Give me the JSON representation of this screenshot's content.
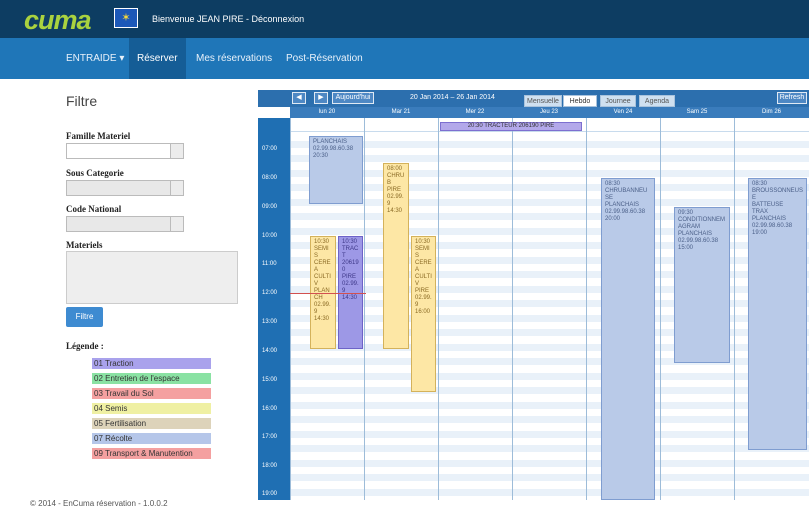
{
  "header": {
    "logo": "cuma",
    "welcome": "Bienvenue JEAN PIRE - Déconnexion"
  },
  "nav": {
    "items": [
      {
        "label": "ENTRAIDE ▾"
      },
      {
        "label": "Réserver"
      },
      {
        "label": "Mes réservations"
      },
      {
        "label": "Post-Réservation"
      }
    ]
  },
  "filter": {
    "title": "Filtre",
    "famille_label": "Famille Materiel",
    "sous_label": "Sous Categorie",
    "code_label": "Code National",
    "materiels_label": "Materiels",
    "button": "Filtre"
  },
  "legend": {
    "title": "Légende :",
    "items": [
      {
        "label": "01 Traction",
        "color": "#a9a2ec"
      },
      {
        "label": "02 Entretien de l'espace",
        "color": "#8ae2a3"
      },
      {
        "label": "03 Travail du Sol",
        "color": "#f4a0a0"
      },
      {
        "label": "04 Semis",
        "color": "#eff0a3"
      },
      {
        "label": "05 Fertilisation",
        "color": "#ddd3ba"
      },
      {
        "label": "07 Récolte",
        "color": "#b5c6e9"
      },
      {
        "label": "09 Transport & Manutention",
        "color": "#f4a0a0"
      }
    ]
  },
  "footer": "© 2014 - EnCuma réservation - 1.0.0.2",
  "calendar": {
    "today_button": "Aujourd'hui",
    "prev": "◀",
    "next": "▶",
    "range": "20 Jan 2014 – 26 Jan 2014",
    "views": [
      "Mensuelle",
      "Hebdo",
      "Journee",
      "Agenda"
    ],
    "refresh": "Refresh",
    "days": [
      "lun 20",
      "Mar 21",
      "Mer 22",
      "Jeu 23",
      "Ven 24",
      "Sam 25",
      "Dim 26"
    ],
    "hours": [
      "07:00",
      "08:00",
      "09:00",
      "10:00",
      "11:00",
      "12:00",
      "13:00",
      "14:00",
      "15:00",
      "16:00",
      "17:00",
      "18:00",
      "19:00"
    ],
    "allday_event": "20:30 TRACTEUR 206190 PIRE",
    "events": [
      {
        "text": "PLANCHAIS\n02.99.98.60.38\n20:30"
      },
      {
        "text": "10:30\nSEMIS\nCEREA\nCULTIV\nPLANCH\n02.99.9\n14:30"
      },
      {
        "text": "10:30\nTRACT\n206190\nPIRE\n02.99.9\n14:30"
      },
      {
        "text": "08:00\nCHRUB\nPIRE\n02.99.9\n14:30"
      },
      {
        "text": "10:30\nSEMIS\nCEREA\nCULTIV\nPIRE\n02.99.9\n16:00"
      },
      {
        "text": "08:30\nCHRUBANNEUSE\nPLANCHAIS\n02.99.98.60.38\n20:00"
      },
      {
        "text": "09:30\nCONDITIONNEM\nAGRAM\nPLANCHAIS\n02.99.98.60.38\n15:00"
      },
      {
        "text": "08:30\nBROUSSONNEUSE\nBATTEUSE\nTRAX\nPLANCHAIS\n02.99.98.60.38\n19:00"
      }
    ]
  }
}
